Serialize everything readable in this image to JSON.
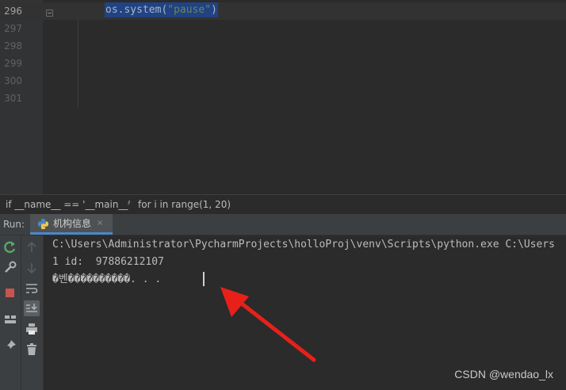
{
  "editor": {
    "lines": [
      {
        "number": "296",
        "code_prefix": "os.system(",
        "code_string": "\"pause\"",
        "code_suffix": ")"
      },
      {
        "number": "297"
      },
      {
        "number": "298"
      },
      {
        "number": "299"
      },
      {
        "number": "300"
      },
      {
        "number": "301"
      }
    ]
  },
  "breadcrumb": {
    "items": [
      "if __name__ == '__main__'",
      "for i in range(1, 20)"
    ]
  },
  "run": {
    "label": "Run:",
    "tab_label": "机构信息",
    "tab_close": "×"
  },
  "console": {
    "lines": [
      "C:\\Users\\Administrator\\PycharmProjects\\holloProj\\venv\\Scripts\\python.exe C:\\Users",
      "1 id:  97886212107",
      "�벤����������. . ."
    ]
  },
  "watermark": "CSDN @wendao_lx",
  "colors": {
    "selection": "#214283",
    "arrow": "#e8201a",
    "tab_underline": "#4a88c7"
  }
}
